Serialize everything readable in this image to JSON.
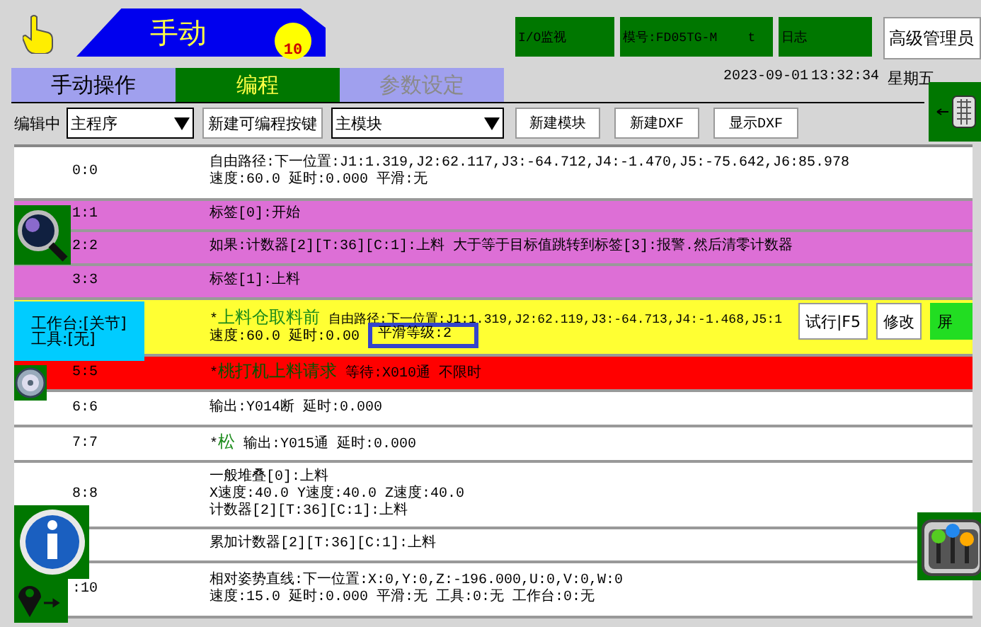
{
  "header": {
    "mode_title": "手动",
    "speed_badge": "10",
    "status_boxes": [
      "I/O监视",
      "模号:FD05TG-M    t",
      "日志"
    ],
    "user_button": "高级管理员"
  },
  "tabs": [
    {
      "label": "手动操作",
      "selected": false,
      "disabled": false
    },
    {
      "label": "编程",
      "selected": true,
      "disabled": false
    },
    {
      "label": "参数设定",
      "selected": false,
      "disabled": true
    }
  ],
  "datetime": {
    "date": "2023-09-01",
    "time": "13:32:34",
    "weekday": "星期五"
  },
  "toolbar": {
    "label": "编辑中",
    "program_select": "主程序",
    "new_key_button": "新建可编程按键",
    "module_select": "主模块",
    "buttons": [
      "新建模块",
      "新建DXF",
      "显示DXF"
    ]
  },
  "program": {
    "rows": [
      {
        "line": "0:0",
        "color": "#ffffff",
        "selected": false,
        "lines": [
          "自由路径:下一位置:J1:1.319,J2:62.117,J3:-64.712,J4:-1.470,J5:-75.642,J6:85.978",
          "速度:60.0 延时:0.000 平滑:无"
        ]
      },
      {
        "line": "1:1",
        "color": "#dd6fd6",
        "selected": false,
        "lines": [
          "标签[0]:开始"
        ]
      },
      {
        "line": "2:2",
        "color": "#dd6fd6",
        "selected": false,
        "lines": [
          "如果:计数器[2][T:36][C:1]:上料 大于等于目标值跳转到标签[3]:报警.然后清零计数器"
        ]
      },
      {
        "line": "3:3",
        "color": "#dd6fd6",
        "selected": false,
        "lines": [
          "标签[1]:上料"
        ]
      },
      {
        "color": "#ffff33",
        "selected": true,
        "marker": "*",
        "name": "上料仓取料前",
        "lines": [
          "自由路径:下一位置:J1:1.319,J2:62.119,J3:-64.713,J4:-1.468,J5:1",
          "速度:60.0 延时:0.00"
        ],
        "popup": "平滑等级:2",
        "actions": [
          "试行|F5",
          "修改",
          "屏"
        ]
      },
      {
        "line": "5:5",
        "color": "#ff0000",
        "selected": false,
        "marker": "*",
        "name": "桃打机上料请求",
        "lines": [
          "等待:X010通 不限时"
        ]
      },
      {
        "line": "6:6",
        "color": "#ffffff",
        "selected": false,
        "lines": [
          "输出:Y014断 延时:0.000"
        ]
      },
      {
        "line": "7:7",
        "color": "#ffffff",
        "selected": false,
        "marker": "*",
        "name": "松",
        "lines": [
          "输出:Y015通 延时:0.000"
        ]
      },
      {
        "line": "8:8",
        "color": "#ffffff",
        "selected": false,
        "lines": [
          "一般堆叠[0]:上料",
          "X速度:40.0 Y速度:40.0 Z速度:40.0",
          "计数器[2][T:36][C:1]:上料"
        ]
      },
      {
        "color": "#ffffff",
        "selected": false,
        "lines": [
          "累加计数器[2][T:36][C:1]:上料"
        ]
      },
      {
        "line": ":10",
        "color": "#ffffff",
        "selected": false,
        "lines": [
          "相对姿势直线:下一位置:X:0,Y:0,Z:-196.000,U:0,V:0,W:0",
          "速度:15.0 延时:0.000 平滑:无 工具:0:无 工作台:0:无"
        ]
      }
    ]
  },
  "coordinate_overlay": {
    "lines": [
      "工作台:[关节]",
      "工具:[无]"
    ]
  }
}
